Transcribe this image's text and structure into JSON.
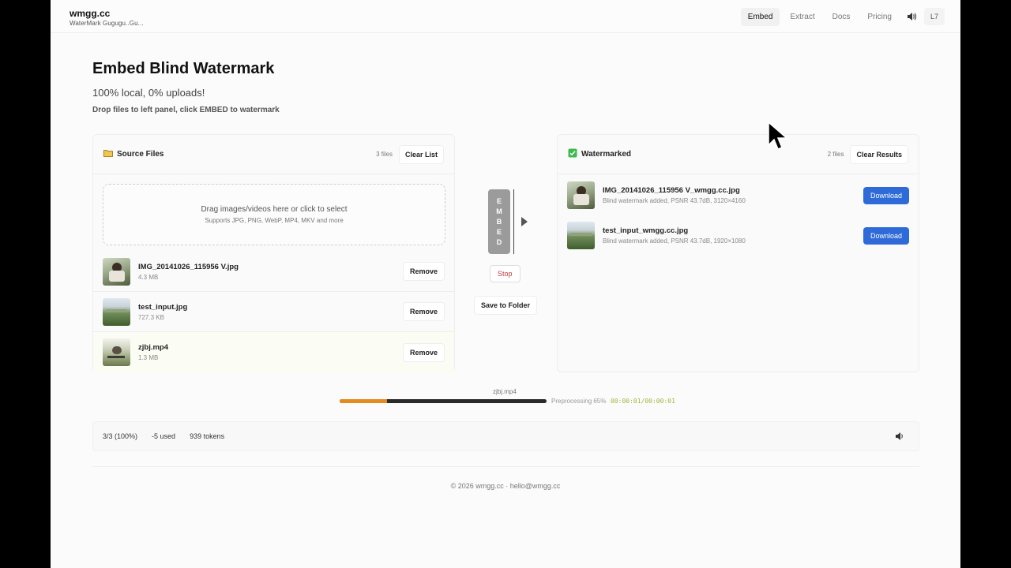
{
  "header": {
    "brand": "wmgg.cc",
    "tagline": "WaterMark Gugugu..Gu...",
    "nav": [
      "Embed",
      "Extract",
      "Docs",
      "Pricing"
    ],
    "sound_icon": "speaker-icon",
    "lang": "L7"
  },
  "hero": {
    "title": "Embed Blind Watermark",
    "subtitle": "100% local, 0% uploads!",
    "hint": "Drop files to left panel, click EMBED to watermark"
  },
  "source": {
    "icon": "folder-icon",
    "title": "Source Files",
    "count": "3 files",
    "clear_label": "Clear List",
    "dropzone_main": "Drag images/videos here or click to select",
    "dropzone_sub": "Supports JPG, PNG, WebP, MP4, MKV and more",
    "remove_label": "Remove",
    "files": [
      {
        "name": "IMG_20141026_115956 V.jpg",
        "size": "4.3 MB"
      },
      {
        "name": "test_input.jpg",
        "size": "727.3 KB"
      },
      {
        "name": "zjbj.mp4",
        "size": "1.3 MB"
      }
    ]
  },
  "results": {
    "icon": "check-icon",
    "title": "Watermarked",
    "count": "2 files",
    "clear_label": "Clear Results",
    "download_label": "Download",
    "files": [
      {
        "name": "IMG_20141026_115956 V_wmgg.cc.jpg",
        "info": "Blind watermark added, PSNR 43.7dB, 3120×4160"
      },
      {
        "name": "test_input_wmgg.cc.jpg",
        "info": "Blind watermark added, PSNR 43.7dB, 1920×1080"
      }
    ]
  },
  "actions": {
    "embed_letters": [
      "E",
      "M",
      "B",
      "E",
      "D"
    ],
    "stop_label": "Stop",
    "save_label": "Save to Folder"
  },
  "progress": {
    "file": "zjbj.mp4",
    "percent": 23,
    "label": "Preprocessing 65%",
    "time": "00:00:01/00:00:01"
  },
  "status": {
    "items": [
      "3/3 (100%)",
      "-5 used",
      "939 tokens"
    ]
  },
  "footer": "© 2026 wmgg.cc · hello@wmgg.cc",
  "colors": {
    "accent": "#2f6bd8",
    "progress": "#e38c1e",
    "stop": "#c23b3b"
  }
}
